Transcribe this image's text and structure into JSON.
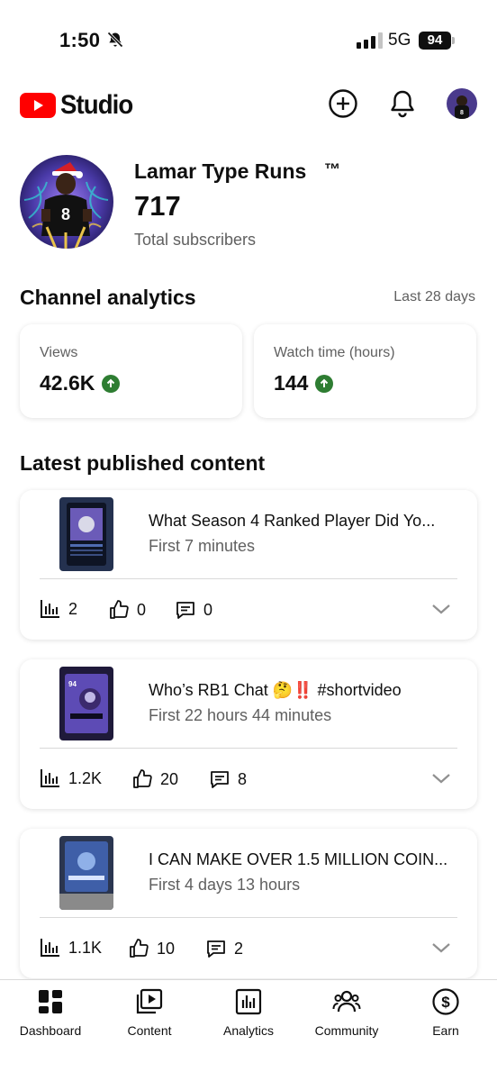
{
  "status_bar": {
    "time": "1:50",
    "network": "5G",
    "battery": "94"
  },
  "header": {
    "logo_text": "Studio",
    "icons": [
      "create-icon",
      "notifications-icon",
      "account-avatar"
    ]
  },
  "channel": {
    "name": "Lamar Type Runs",
    "tm": "™",
    "subscribers": "717",
    "subscribers_label": "Total subscribers"
  },
  "analytics": {
    "title": "Channel analytics",
    "range": "Last 28 days",
    "stats": [
      {
        "label": "Views",
        "value": "42.6K",
        "trend": "up"
      },
      {
        "label": "Watch time (hours)",
        "value": "144",
        "trend": "up"
      }
    ]
  },
  "latest": {
    "title": "Latest published content",
    "items": [
      {
        "title": "What Season 4 Ranked Player Did Yo...",
        "time": "First 7 minutes",
        "views": "2",
        "likes": "0",
        "comments": "0"
      },
      {
        "title": "Who’s RB1 Chat 🤔‼️ #shortvideo",
        "time": "First 22 hours 44 minutes",
        "views": "1.2K",
        "likes": "20",
        "comments": "8"
      },
      {
        "title": "I CAN MAKE OVER 1.5 MILLION COIN...",
        "time": "First 4 days 13 hours",
        "views": "1.1K",
        "likes": "10",
        "comments": "2"
      }
    ]
  },
  "nav": [
    {
      "label": "Dashboard",
      "icon": "dashboard-icon",
      "active": true
    },
    {
      "label": "Content",
      "icon": "content-icon"
    },
    {
      "label": "Analytics",
      "icon": "analytics-icon"
    },
    {
      "label": "Community",
      "icon": "community-icon"
    },
    {
      "label": "Earn",
      "icon": "earn-icon"
    }
  ],
  "colors": {
    "brand_red": "#ff0000",
    "trend_green": "#2e7d32",
    "secondary_text": "#606060"
  }
}
